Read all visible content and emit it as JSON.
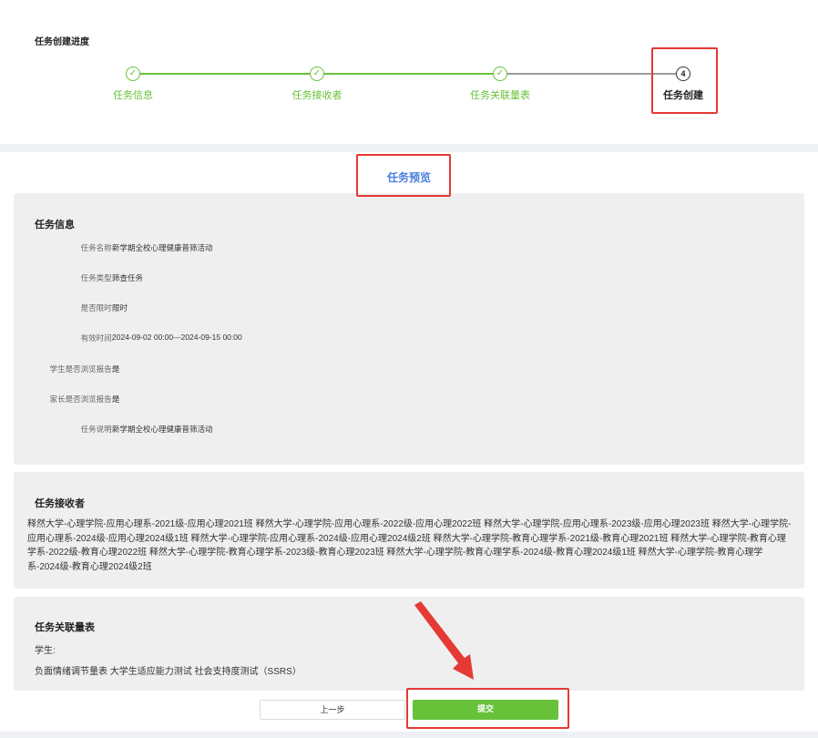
{
  "progress": {
    "title": "任务创建进度",
    "steps": [
      {
        "label": "任务信息",
        "marker": "✓",
        "state": "done"
      },
      {
        "label": "任务接收者",
        "marker": "✓",
        "state": "done"
      },
      {
        "label": "任务关联量表",
        "marker": "✓",
        "state": "done"
      },
      {
        "label": "任务创建",
        "marker": "4",
        "state": "active"
      }
    ]
  },
  "preview": {
    "title": "任务预览"
  },
  "task_info": {
    "title": "任务信息",
    "rows": [
      {
        "key": "任务名称:",
        "value": "新学期全校心理健康普筛活动"
      },
      {
        "key": "任务类型:",
        "value": "筛查任务"
      },
      {
        "key": "是否限时:",
        "value": "限时"
      },
      {
        "key": "有效时间:",
        "value": "2024-09-02 00:00---2024-09-15 00:00"
      },
      {
        "key": "学生是否浏览报告:",
        "value": "是"
      },
      {
        "key": "家长是否浏览报告:",
        "value": "是"
      },
      {
        "key": "任务说明:",
        "value": "新学期全校心理健康普筛活动"
      }
    ]
  },
  "receivers": {
    "title": "任务接收者",
    "text": "释然大学-心理学院-应用心理系-2021级-应用心理2021班   释然大学-心理学院-应用心理系-2022级-应用心理2022班   释然大学-心理学院-应用心理系-2023级-应用心理2023班   释然大学-心理学院-应用心理系-2024级-应用心理2024级1班   释然大学-心理学院-应用心理系-2024级-应用心理2024级2班   释然大学-心理学院-教育心理学系-2021级-教育心理2021班   释然大学-心理学院-教育心理学系-2022级-教育心理2022班   释然大学-心理学院-教育心理学系-2023级-教育心理2023班   释然大学-心理学院-教育心理学系-2024级-教育心理2024级1班   释然大学-心理学院-教育心理学系-2024级-教育心理2024级2班"
  },
  "scales": {
    "title": "任务关联量表",
    "group_label": "学生:",
    "items_text": "负面情绪调节量表   大学生适应能力测试   社会支持度测试（SSRS）"
  },
  "buttons": {
    "prev": "上一步",
    "submit": "提交"
  },
  "colors": {
    "accent": "#67c23a",
    "highlight": "#e53935",
    "preview_title": "#4a7ede"
  }
}
